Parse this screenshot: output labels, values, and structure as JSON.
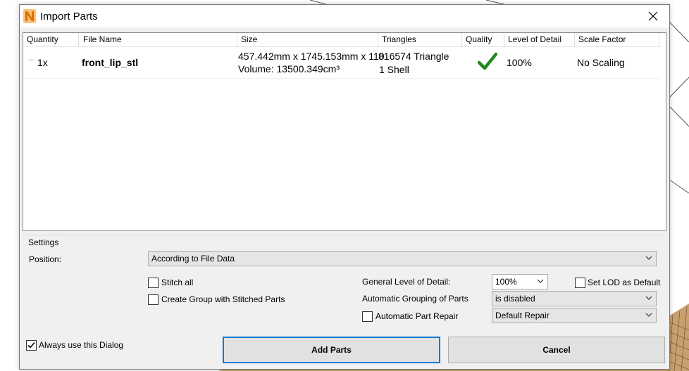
{
  "window": {
    "title": "Import Parts"
  },
  "table": {
    "columns": [
      "Quantity",
      "File Name",
      "Size",
      "Triangles",
      "Quality",
      "Level of Detail",
      "Scale Factor"
    ],
    "rows": [
      {
        "quantity": "1x",
        "file_name": "front_lip_stl",
        "size_line1": "457.442mm x 1745.153mm x 110",
        "volume": "Volume: 13500.349cm³",
        "triangles_line1": "816574 Triangle",
        "triangles_line2": "1 Shell",
        "quality_icon": "checkmark-icon",
        "level_of_detail": "100%",
        "scale_factor": "No Scaling"
      }
    ]
  },
  "settings": {
    "title": "Settings",
    "position_label": "Position:",
    "position_value": "According to File Data",
    "stitch_all_label": "Stitch all",
    "stitch_all_checked": false,
    "create_group_label": "Create Group with Stitched Parts",
    "create_group_checked": false,
    "general_lod_label": "General Level of Detail:",
    "general_lod_value": "100%",
    "set_lod_default_label": "Set LOD as Default",
    "set_lod_default_checked": false,
    "auto_grouping_label": "Automatic Grouping of Parts",
    "auto_grouping_value": "is disabled",
    "auto_repair_label": "Automatic Part Repair",
    "auto_repair_checked": false,
    "repair_value": "Default Repair"
  },
  "footer": {
    "always_use_label": "Always use this Dialog",
    "always_use_checked": true,
    "add_parts_label": "Add Parts",
    "cancel_label": "Cancel"
  },
  "colors": {
    "accent": "#0078d7",
    "check_green": "#1e8a1e",
    "logo_orange": "#f08a00"
  }
}
